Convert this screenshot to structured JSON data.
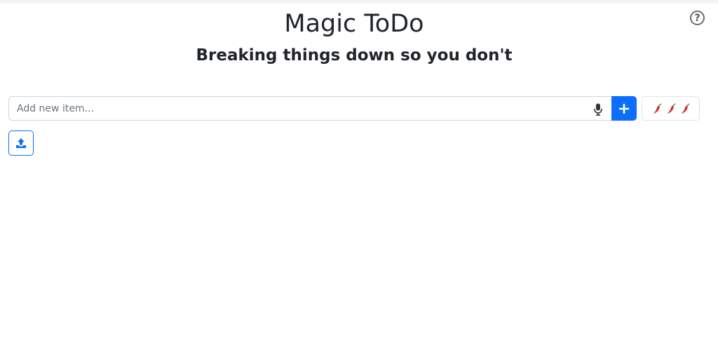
{
  "header": {
    "title": "Magic ToDo",
    "subtitle": "Breaking things down so you don't",
    "help_label": "?"
  },
  "new_item": {
    "placeholder": "Add new item...",
    "value": "",
    "mic_icon": "microphone-icon",
    "add_icon": "plus-icon"
  },
  "spiciness": {
    "icon": "chili-pepper-icon",
    "level": 3
  },
  "upload": {
    "icon": "upload-icon"
  },
  "colors": {
    "primary": "#0d6efd",
    "text": "#212529",
    "border": "#ced4da",
    "pepper_red": "#d42b2b",
    "pepper_green": "#3c9a2e"
  }
}
